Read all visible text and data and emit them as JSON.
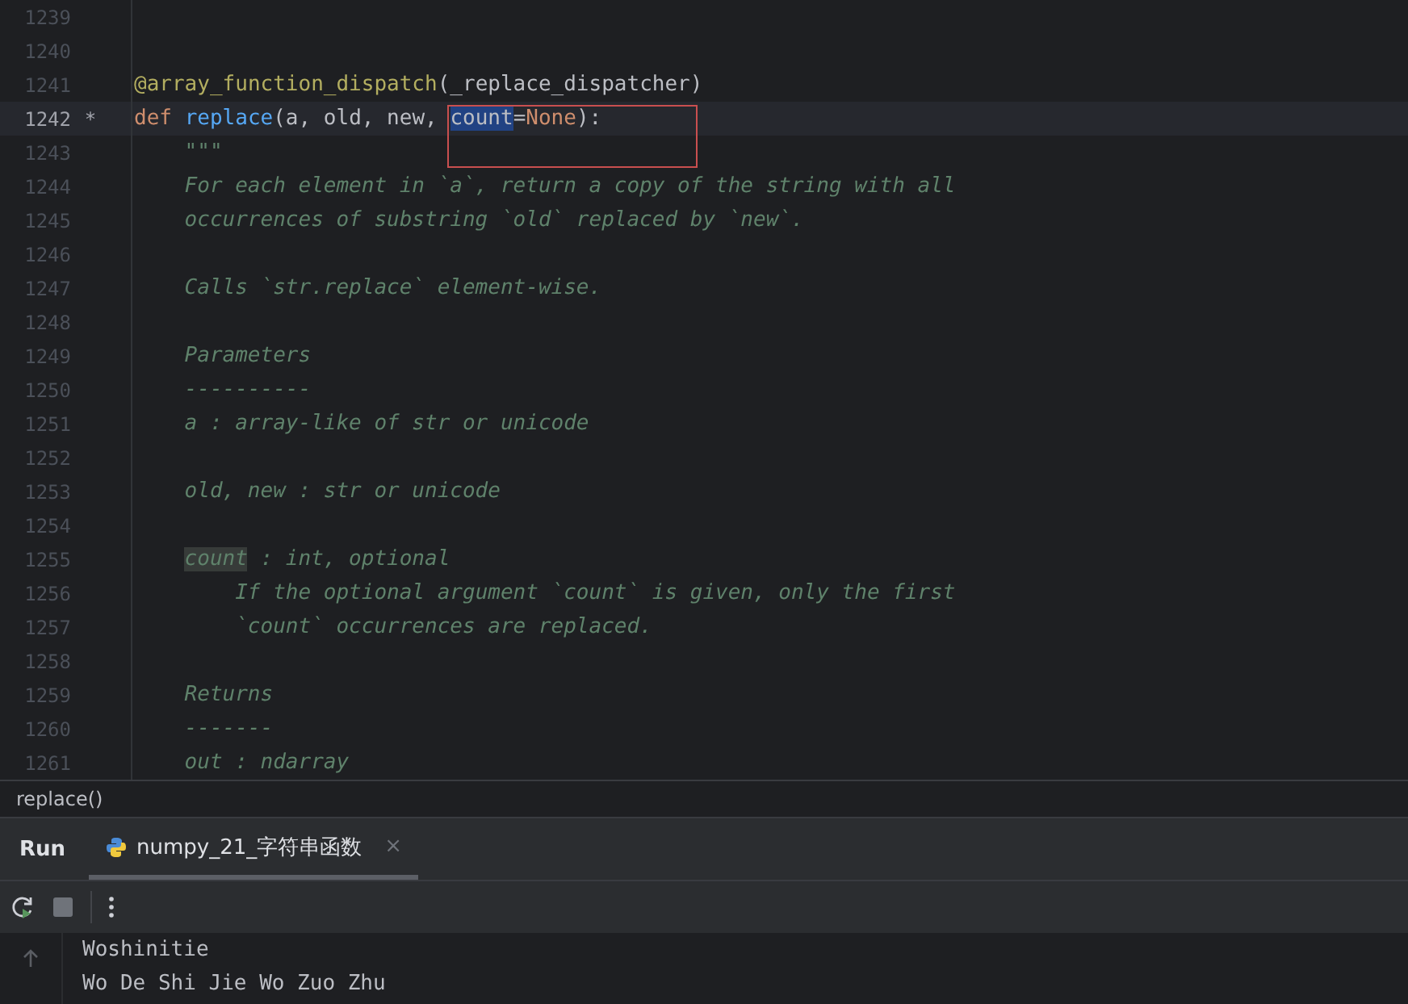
{
  "editor": {
    "lines": [
      {
        "number": "1239",
        "selected": false,
        "kind": "code"
      },
      {
        "number": "1240",
        "selected": false,
        "kind": "code"
      },
      {
        "number": "1241",
        "selected": false,
        "kind": "code",
        "segments": [
          {
            "kind": "decorator",
            "text": "@array_function_dispatch"
          },
          {
            "kind": "plain",
            "text": "(_replace_dispatcher)"
          }
        ]
      },
      {
        "number": "1242",
        "selected": true,
        "kind": "code",
        "marker": "*",
        "segments": [
          {
            "kind": "keyword",
            "text": "def "
          },
          {
            "kind": "function",
            "text": "replace"
          },
          {
            "kind": "plain",
            "text": "(a, old, new, "
          },
          {
            "kind": "selection",
            "text": "count",
            "boxed": true
          },
          {
            "kind": "plain",
            "text": "=",
            "boxed": true
          },
          {
            "kind": "keyword",
            "text": "None",
            "boxed": true
          },
          {
            "kind": "plain",
            "text": "):",
            "boxed": true
          }
        ]
      },
      {
        "number": "1243",
        "selected": false,
        "kind": "docstring",
        "segments": [
          {
            "kind": "doc",
            "text": "\"\"\""
          }
        ]
      },
      {
        "number": "1244",
        "selected": false,
        "kind": "docstring",
        "segments": [
          {
            "kind": "doc",
            "text": "For each element in `a`, return a copy of the string with all"
          }
        ]
      },
      {
        "number": "1245",
        "selected": false,
        "kind": "docstring",
        "segments": [
          {
            "kind": "doc",
            "text": "occurrences of substring `old` replaced by `new`."
          }
        ]
      },
      {
        "number": "1246",
        "selected": false,
        "kind": "docstring"
      },
      {
        "number": "1247",
        "selected": false,
        "kind": "docstring",
        "segments": [
          {
            "kind": "doc",
            "text": "Calls `str.replace` element-wise."
          }
        ]
      },
      {
        "number": "1248",
        "selected": false,
        "kind": "docstring"
      },
      {
        "number": "1249",
        "selected": false,
        "kind": "docstring",
        "segments": [
          {
            "kind": "doc",
            "text": "Parameters"
          }
        ]
      },
      {
        "number": "1250",
        "selected": false,
        "kind": "docstring",
        "segments": [
          {
            "kind": "doc",
            "text": "----------"
          }
        ]
      },
      {
        "number": "1251",
        "selected": false,
        "kind": "docstring",
        "segments": [
          {
            "kind": "doc",
            "text": "a : array-like of str or unicode"
          }
        ]
      },
      {
        "number": "1252",
        "selected": false,
        "kind": "docstring"
      },
      {
        "number": "1253",
        "selected": false,
        "kind": "docstring",
        "segments": [
          {
            "kind": "doc",
            "text": "old, new : str or unicode"
          }
        ]
      },
      {
        "number": "1254",
        "selected": false,
        "kind": "docstring"
      },
      {
        "number": "1255",
        "selected": false,
        "kind": "docstring",
        "segments": [
          {
            "kind": "doc-highlight",
            "text": "count"
          },
          {
            "kind": "doc",
            "text": " : int, optional"
          }
        ]
      },
      {
        "number": "1256",
        "selected": false,
        "kind": "docstring-indented",
        "segments": [
          {
            "kind": "doc",
            "text": "If the optional argument `count` is given, only the first"
          }
        ]
      },
      {
        "number": "1257",
        "selected": false,
        "kind": "docstring-indented",
        "segments": [
          {
            "kind": "doc",
            "text": "`count` occurrences are replaced."
          }
        ]
      },
      {
        "number": "1258",
        "selected": false,
        "kind": "docstring"
      },
      {
        "number": "1259",
        "selected": false,
        "kind": "docstring",
        "segments": [
          {
            "kind": "doc",
            "text": "Returns"
          }
        ]
      },
      {
        "number": "1260",
        "selected": false,
        "kind": "docstring",
        "segments": [
          {
            "kind": "doc",
            "text": "-------"
          }
        ]
      },
      {
        "number": "1261",
        "selected": false,
        "kind": "docstring",
        "segments": [
          {
            "kind": "doc",
            "text": "out : ndarray"
          }
        ]
      }
    ]
  },
  "breadcrumb": "replace()",
  "tool_window": {
    "title": "Run",
    "tabs": [
      {
        "label": "numpy_21_字符串函数",
        "selected": true,
        "close": "×"
      }
    ]
  },
  "console": {
    "lines": [
      "Woshinitie",
      "Wo De Shi Jie Wo Zuo Zhu"
    ]
  }
}
